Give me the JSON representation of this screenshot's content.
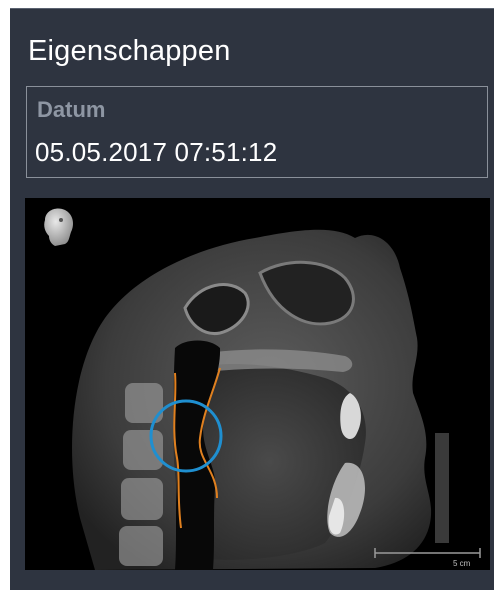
{
  "panel": {
    "title": "Eigenschappen",
    "field": {
      "label": "Datum",
      "value": "05.05.2017 07:51:12"
    }
  },
  "viewer": {
    "scale_label": "5 cm",
    "orientation_icon": "head-orientation-icon",
    "colors": {
      "background": "#000000",
      "airway_outline": "#e0801f",
      "focus_circle": "#1f8fd0"
    }
  }
}
